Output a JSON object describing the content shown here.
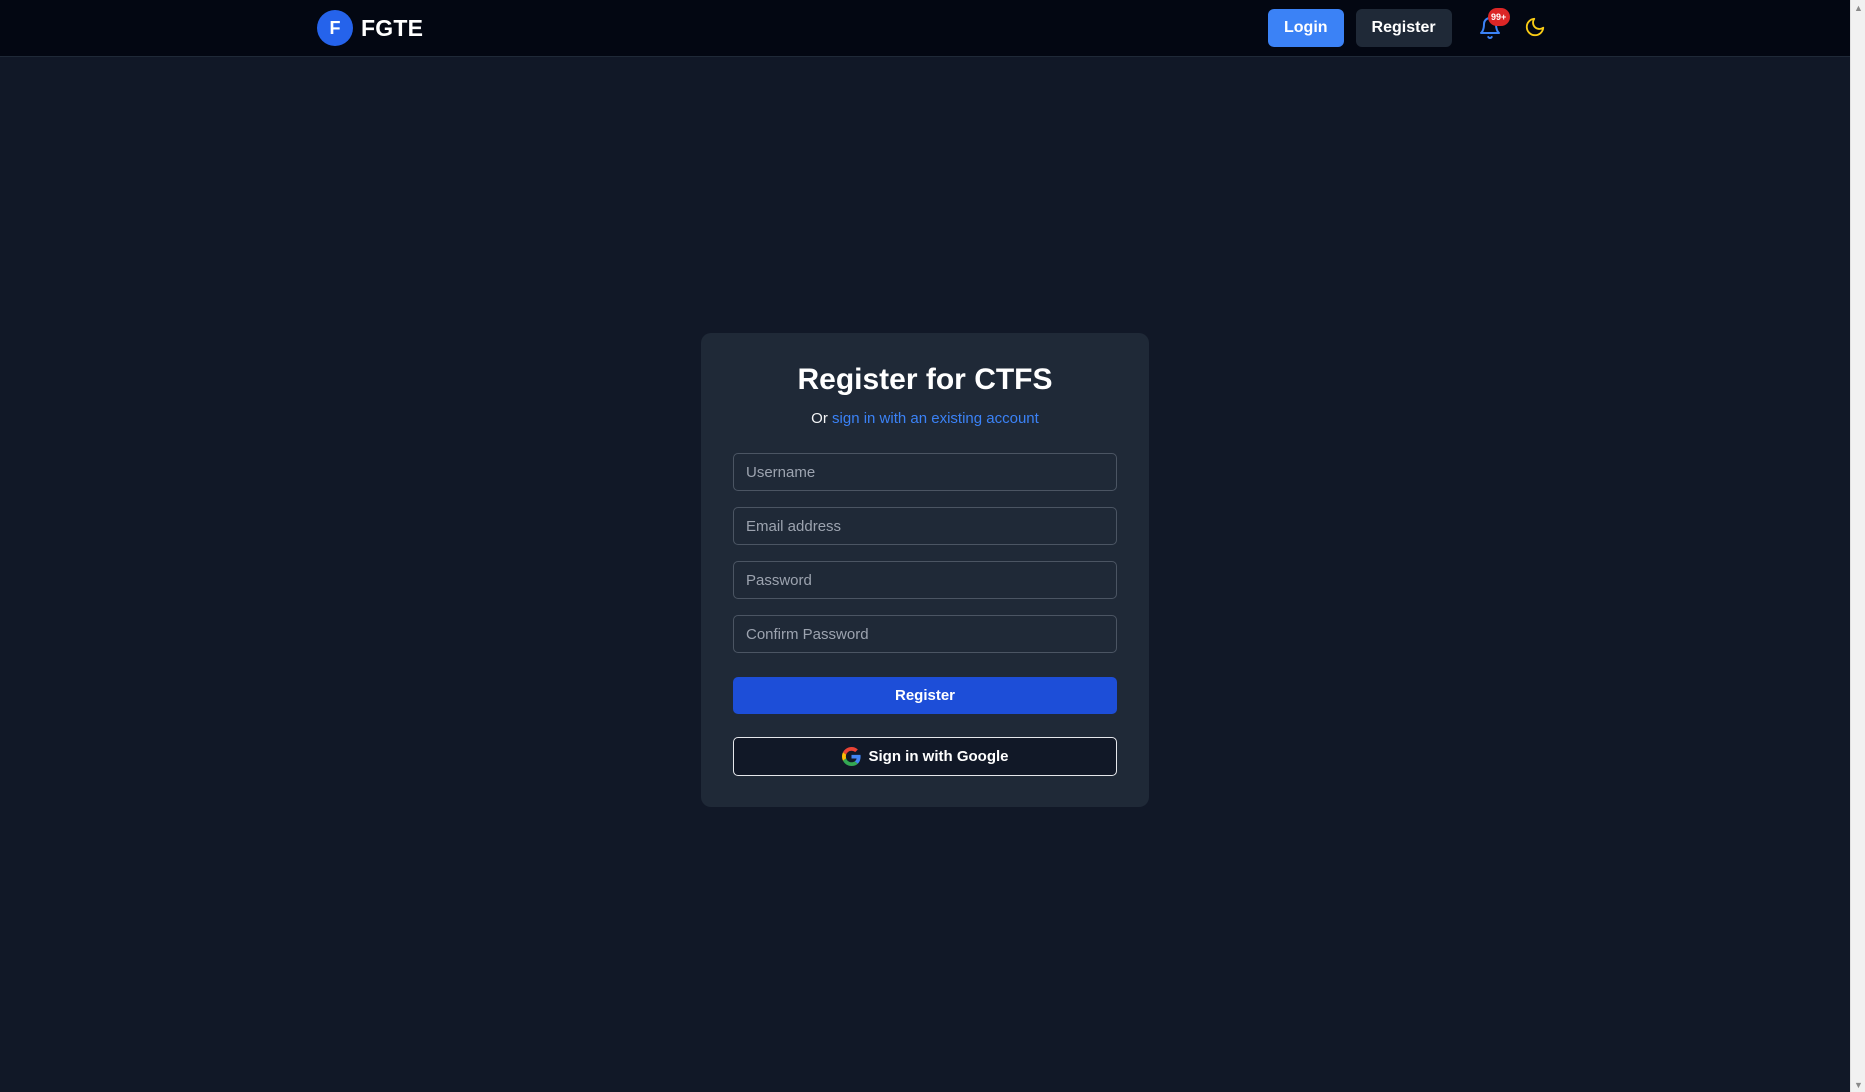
{
  "header": {
    "logo_letter": "F",
    "brand": "FGTE",
    "login_label": "Login",
    "register_label": "Register",
    "notification_count": "99+"
  },
  "form": {
    "title": "Register for CTFS",
    "subtitle_prefix": "Or",
    "subtitle_link": "sign in with an existing account",
    "username_placeholder": "Username",
    "email_placeholder": "Email address",
    "password_placeholder": "Password",
    "confirm_password_placeholder": "Confirm Password",
    "register_button": "Register",
    "google_button": "Sign in with Google"
  },
  "icons": {
    "notifications": "bell-icon",
    "theme_toggle": "moon-icon",
    "google": "google-icon"
  },
  "colors": {
    "background": "#111827",
    "header": "#030712",
    "card": "#1f2937",
    "accent": "#3b82f6",
    "primary_button": "#1d4ed8",
    "badge": "#dc2626",
    "moon": "#facc15"
  }
}
